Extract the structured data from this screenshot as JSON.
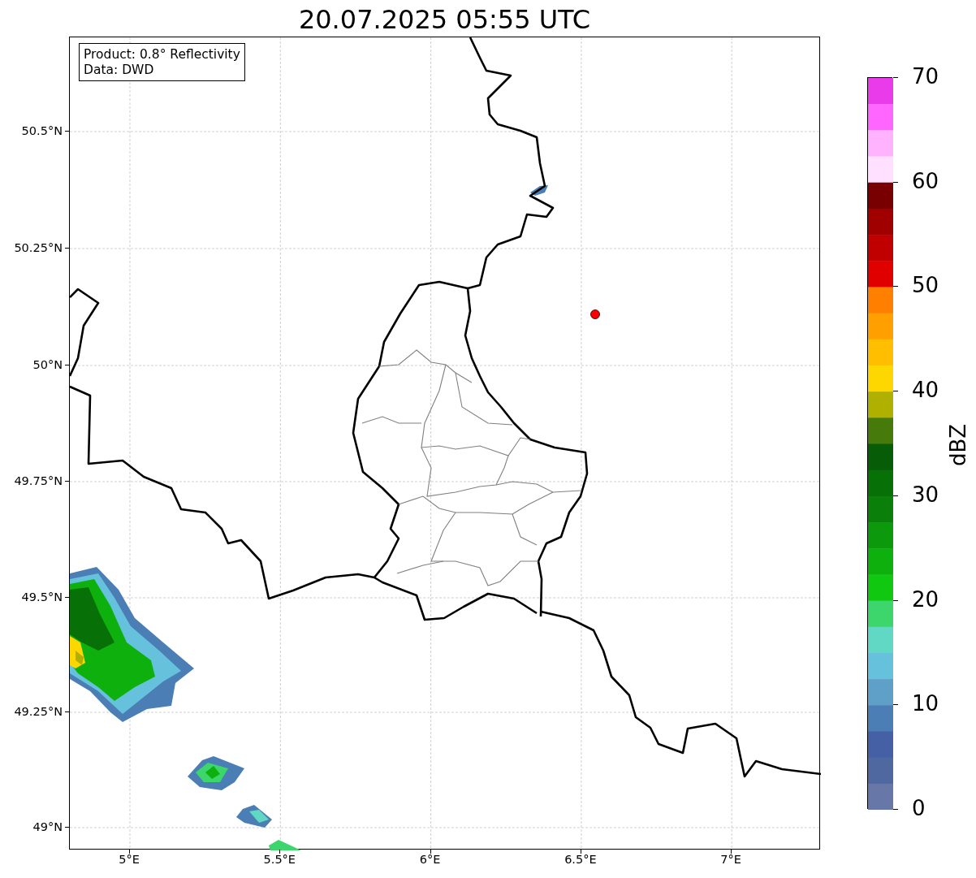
{
  "title": "20.07.2025 05:55 UTC",
  "info_box": [
    "Product: 0.8° Reflectivity",
    "Data: DWD"
  ],
  "y_axis": {
    "ticks": [
      "50.5°N",
      "50.25°N",
      "50°N",
      "49.75°N",
      "49.5°N",
      "49.25°N",
      "49°N"
    ]
  },
  "x_axis": {
    "ticks": [
      "5°E",
      "5.5°E",
      "6°E",
      "6.5°E",
      "7°E"
    ]
  },
  "colorbar": {
    "label": "dBZ",
    "ticks": [
      "70",
      "60",
      "50",
      "40",
      "30",
      "20",
      "10",
      "0"
    ],
    "segments": [
      {
        "color": "#e93bea"
      },
      {
        "color": "#ff66ff"
      },
      {
        "color": "#ffb3ff"
      },
      {
        "color": "#ffe0ff"
      },
      {
        "color": "#780000"
      },
      {
        "color": "#a00000"
      },
      {
        "color": "#c00000"
      },
      {
        "color": "#e00000"
      },
      {
        "color": "#ff7f00"
      },
      {
        "color": "#ff9f00"
      },
      {
        "color": "#ffbf00"
      },
      {
        "color": "#ffd700"
      },
      {
        "color": "#b0b000"
      },
      {
        "color": "#467a0a"
      },
      {
        "color": "#075c07"
      },
      {
        "color": "#077007"
      },
      {
        "color": "#0a800a"
      },
      {
        "color": "#0c9a0c"
      },
      {
        "color": "#0eb00e"
      },
      {
        "color": "#10c810"
      },
      {
        "color": "#3cd66c"
      },
      {
        "color": "#60d8c4"
      },
      {
        "color": "#66c2dc"
      },
      {
        "color": "#5ea0c8"
      },
      {
        "color": "#4a7eb4"
      },
      {
        "color": "#4560a4"
      },
      {
        "color": "#5068a0"
      },
      {
        "color": "#6677a8"
      }
    ]
  }
}
